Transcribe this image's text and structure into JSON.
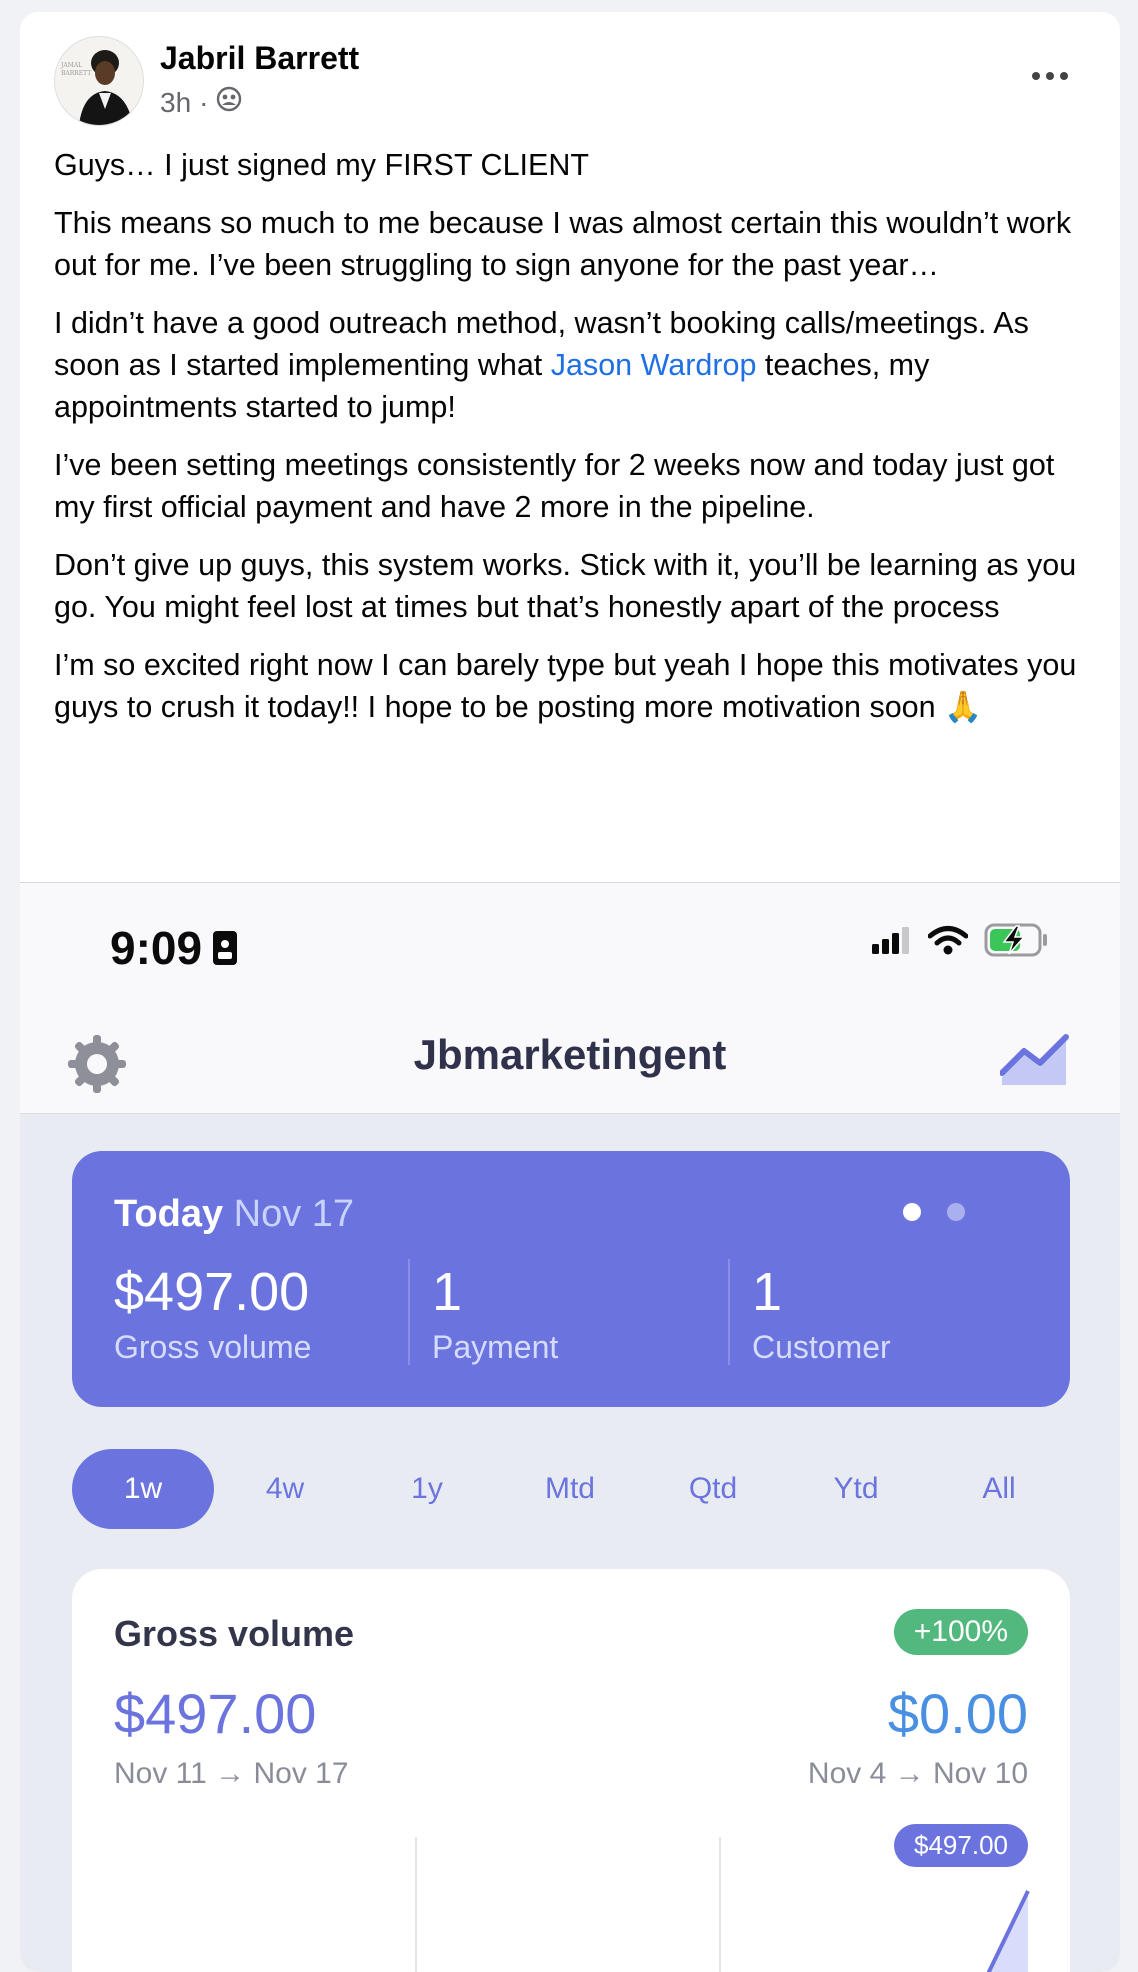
{
  "post": {
    "author": "Jabril Barrett",
    "time": "3h",
    "separator": "·",
    "avatar_text_1": "JAMAL",
    "avatar_text_2": "BARRETT",
    "paragraphs": {
      "p1": "Guys… I just signed my FIRST CLIENT",
      "p2": "This means so much to me because I was almost certain this wouldn’t work out for me. I’ve been struggling to sign anyone for the past year…",
      "p3_before": "I didn’t have a good outreach method, wasn’t booking calls/meetings. As soon as I started implementing what ",
      "p3_link": "Jason Wardrop",
      "p3_after": " teaches, my appointments started to jump!",
      "p4": "I’ve been setting meetings consistently for 2 weeks now and today just got my first official payment and have 2 more in the pipeline.",
      "p5": "Don’t give up guys, this system works. Stick with it, you’ll be learning as you go. You might feel lost at times but that’s honestly apart of the process",
      "p6": "I’m so excited right now I can barely type but yeah I hope this motivates you guys to crush it today!! I hope to be posting more motivation soon 🙏"
    }
  },
  "phone": {
    "time": "9:09",
    "app_title": "Jbmarketingent",
    "today": {
      "label": "Today",
      "date": "Nov 17",
      "gross_value": "$497.00",
      "gross_label": "Gross volume",
      "payments_value": "1",
      "payments_label": "Payment",
      "customers_value": "1",
      "customers_label": "Customer"
    },
    "ranges": [
      "1w",
      "4w",
      "1y",
      "Mtd",
      "Qtd",
      "Ytd",
      "All"
    ],
    "gross": {
      "title": "Gross volume",
      "change": "+100%",
      "current_value": "$497.00",
      "current_range": "Nov 11 → Nov 17",
      "previous_value": "$0.00",
      "previous_range": "Nov 4 → Nov 10",
      "tooltip": "$497.00"
    }
  },
  "colors": {
    "accent": "#6b74de",
    "link": "#1f6fe5",
    "positive": "#52b87d",
    "previous": "#4a90e2"
  }
}
